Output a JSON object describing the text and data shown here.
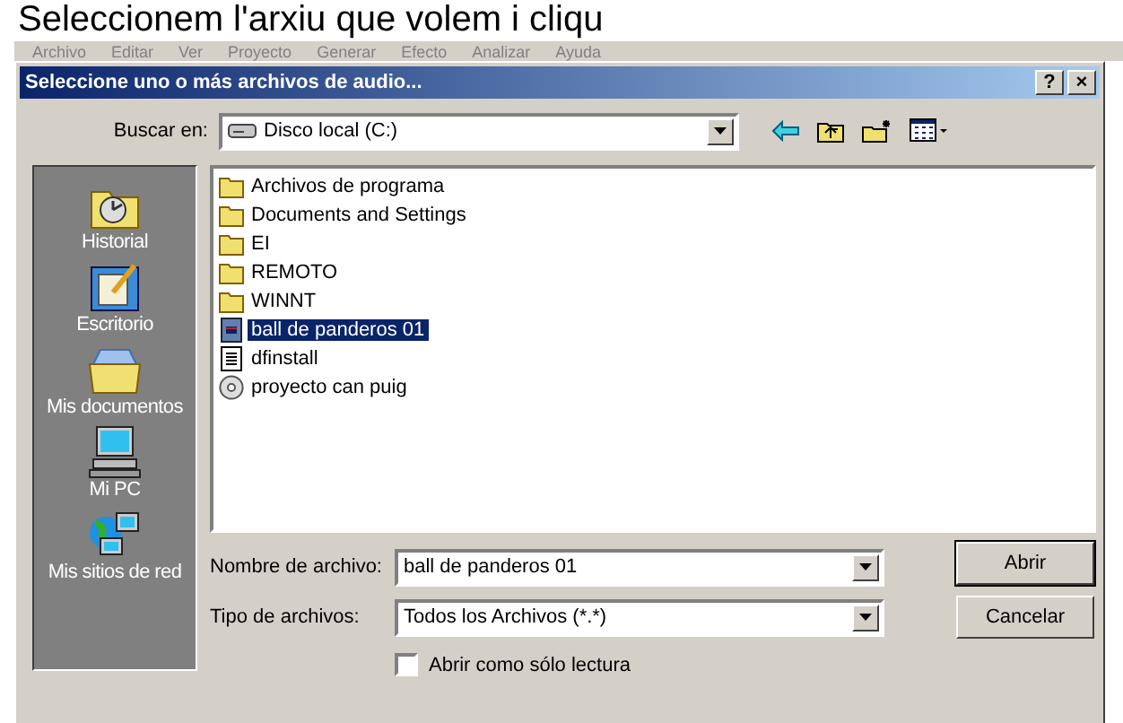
{
  "heading": "Seleccionem l'arxiu que volem i cliqu",
  "menu_bar": [
    "Archivo",
    "Editar",
    "Ver",
    "Proyecto",
    "Generar",
    "Efecto",
    "Analizar",
    "Ayuda"
  ],
  "dialog": {
    "title": "Seleccione uno o más archivos de audio...",
    "title_buttons": [
      "?",
      "×"
    ],
    "look_in": {
      "label": "Buscar en:",
      "value": "Disco local (C:)"
    },
    "places": [
      {
        "label": "Historial",
        "kind": "history"
      },
      {
        "label": "Escritorio",
        "kind": "desktop"
      },
      {
        "label": "Mis documentos",
        "kind": "documents"
      },
      {
        "label": "Mi PC",
        "kind": "computer"
      },
      {
        "label": "Mis sitios de red",
        "kind": "network"
      }
    ],
    "files": [
      {
        "name": "Archivos de programa",
        "kind": "folder",
        "selected": false
      },
      {
        "name": "Documents and Settings",
        "kind": "folder",
        "selected": false
      },
      {
        "name": "EI",
        "kind": "folder",
        "selected": false
      },
      {
        "name": "REMOTO",
        "kind": "folder",
        "selected": false
      },
      {
        "name": "WINNT",
        "kind": "folder",
        "selected": false
      },
      {
        "name": "ball de panderos 01",
        "kind": "audio",
        "selected": true
      },
      {
        "name": "dfinstall",
        "kind": "text",
        "selected": false
      },
      {
        "name": "proyecto can puig",
        "kind": "cd",
        "selected": false
      }
    ],
    "file_name": {
      "label": "Nombre de archivo:",
      "value": "ball de panderos 01"
    },
    "file_type": {
      "label": "Tipo de archivos:",
      "value": "Todos los Archivos (*.*)"
    },
    "buttons": [
      "Abrir",
      "Cancelar"
    ],
    "read_only": {
      "label": "Abrir como sólo lectura",
      "checked": false
    }
  }
}
